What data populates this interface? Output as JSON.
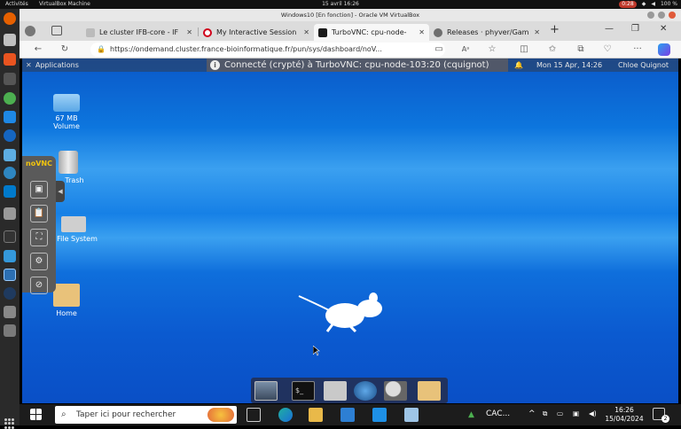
{
  "ubuntu_bar": {
    "activities": "Activités",
    "app_name": "VirtualBox Machine",
    "clock": "15 avril  16:26",
    "battery_badge": "0:28",
    "battery_pct": "100 %"
  },
  "vbox": {
    "title": "Windows10 [En fonction] - Oracle VM VirtualBox"
  },
  "browser": {
    "tabs": [
      {
        "label": "Le cluster IFB-core - IF",
        "favicon": "ifb-icon"
      },
      {
        "label": "My Interactive Session",
        "favicon": "opera-icon"
      },
      {
        "label": "TurboVNC: cpu-node-",
        "favicon": "vnc-icon",
        "active": true
      },
      {
        "label": "Releases · phyver/Gam",
        "favicon": "github-icon"
      }
    ],
    "new_tab": "+",
    "url": "https://ondemand.cluster.france-bioinformatique.fr/pun/sys/dashboard/noV..."
  },
  "vnc": {
    "applications_menu": "Applications",
    "banner": "Connecté (crypté) à TurboVNC: cpu-node-103:20 (cquignot)",
    "panel_clock": "Mon 15 Apr, 14:26",
    "panel_user": "Chloe Quignot",
    "logo": "noVNC",
    "desktop_icons": [
      {
        "label_line1": "67 MB",
        "label_line2": "Volume"
      },
      {
        "label_line1": "Trash",
        "label_line2": ""
      },
      {
        "label_line1": "File System",
        "label_line2": ""
      },
      {
        "label_line1": "Home",
        "label_line2": ""
      }
    ]
  },
  "taskbar": {
    "search_placeholder": "Taper ici pour rechercher",
    "weather": "CAC...",
    "time": "16:26",
    "date": "15/04/2024",
    "notification_count": "2"
  }
}
